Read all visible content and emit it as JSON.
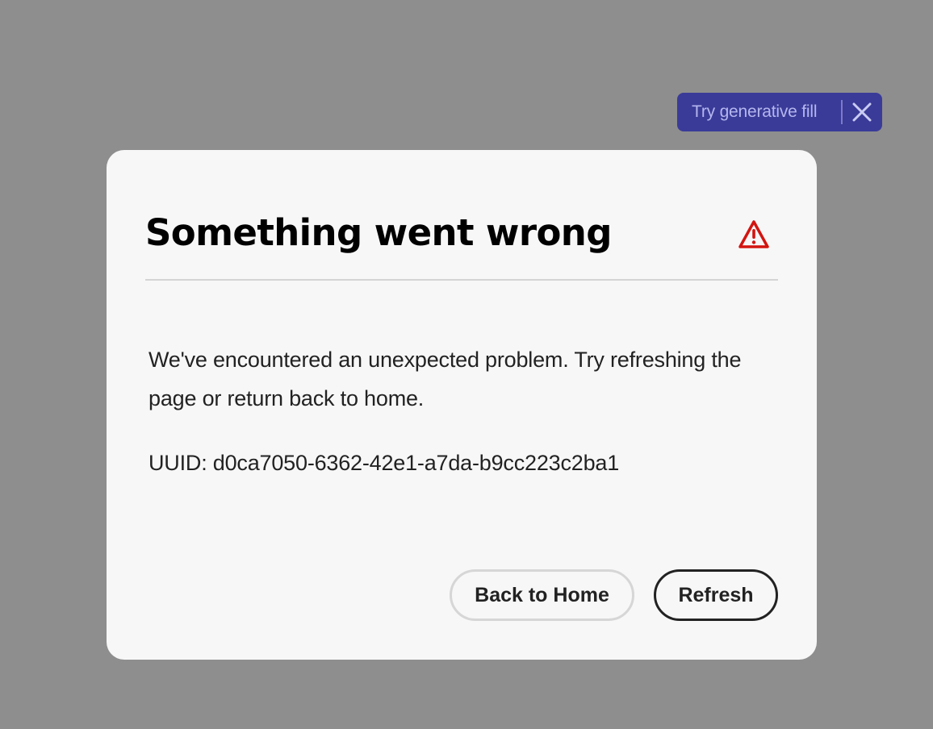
{
  "toast": {
    "label": "Try generative fill",
    "close_icon": "close-icon",
    "background_color": "#3a3b98"
  },
  "dialog": {
    "title": "Something went wrong",
    "alert_icon": "alert-triangle-icon",
    "alert_color": "#d31510",
    "message": "We've encountered an unexpected problem. Try refreshing the page or return back to home.",
    "uuid": "UUID: d0ca7050-6362-42e1-a7da-b9cc223c2ba1",
    "buttons": {
      "back_home": "Back to Home",
      "refresh": "Refresh"
    }
  }
}
